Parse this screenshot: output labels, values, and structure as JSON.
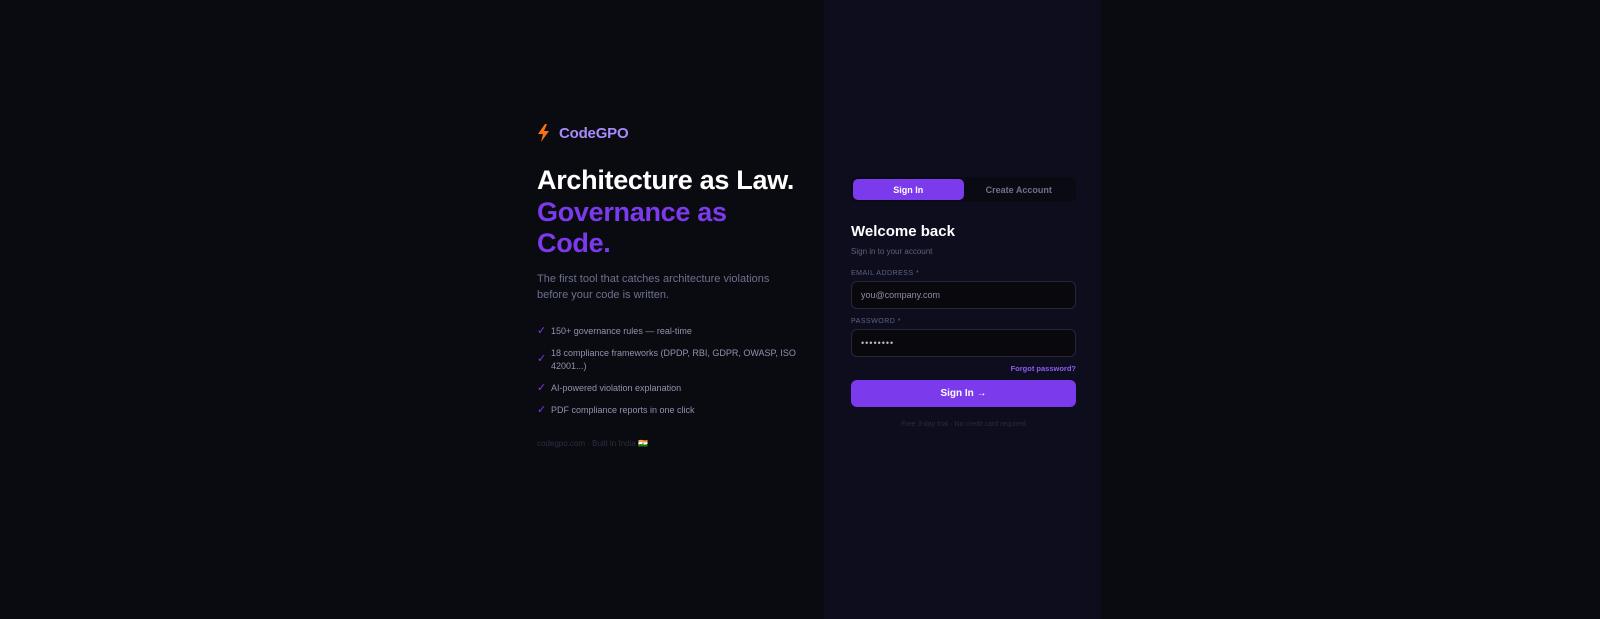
{
  "brand": {
    "name": "CodeGPO",
    "icon": "bolt-icon",
    "icon_color": "#f97316"
  },
  "hero": {
    "headline_line1": "Architecture as Law.",
    "headline_line2": "Governance as Code.",
    "tagline": "The first tool that catches architecture violations before your code is written.",
    "features": [
      "150+ governance rules — real-time",
      "18 compliance frameworks (DPDP, RBI, GDPR, OWASP, ISO 42001...)",
      "AI-powered violation explanation",
      "PDF compliance reports in one click"
    ],
    "footer": "codegpo.com · Built in India 🇮🇳"
  },
  "auth": {
    "tabs": {
      "sign_in": "Sign In",
      "create_account": "Create Account"
    },
    "title": "Welcome back",
    "subtitle": "Sign in to your account",
    "email_label": "EMAIL ADDRESS *",
    "email_placeholder": "you@company.com",
    "password_label": "PASSWORD *",
    "password_value": "••••••••",
    "forgot": "Forgot password?",
    "submit": "Sign In →",
    "trial_note": "Free 3-day trial · No credit card required"
  },
  "colors": {
    "accent": "#7c3aed",
    "background": "#0a0a11",
    "panel": "#0e0d1e"
  }
}
